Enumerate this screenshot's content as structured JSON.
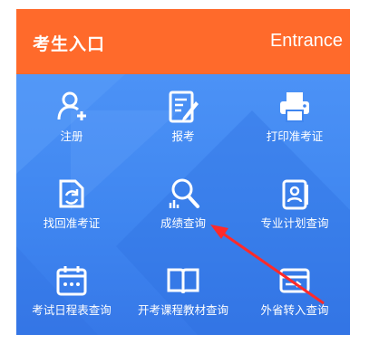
{
  "header": {
    "title": "考生入口",
    "subtitle": "Entrance"
  },
  "colors": {
    "header_bg": "#ff6a2b",
    "body_bg": "#3f86f0",
    "arrow": "#ff2a2a"
  },
  "items": [
    {
      "label": "注册",
      "icon": "user-add-icon"
    },
    {
      "label": "报考",
      "icon": "form-edit-icon"
    },
    {
      "label": "打印准考证",
      "icon": "printer-icon"
    },
    {
      "label": "找回准考证",
      "icon": "retrieve-doc-icon"
    },
    {
      "label": "成绩查询",
      "icon": "search-person-icon"
    },
    {
      "label": "专业计划查询",
      "icon": "id-card-icon"
    },
    {
      "label": "考试日程表查询",
      "icon": "calendar-icon"
    },
    {
      "label": "开考课程教材查询",
      "icon": "book-icon"
    },
    {
      "label": "外省转入查询",
      "icon": "card-transfer-icon"
    }
  ]
}
